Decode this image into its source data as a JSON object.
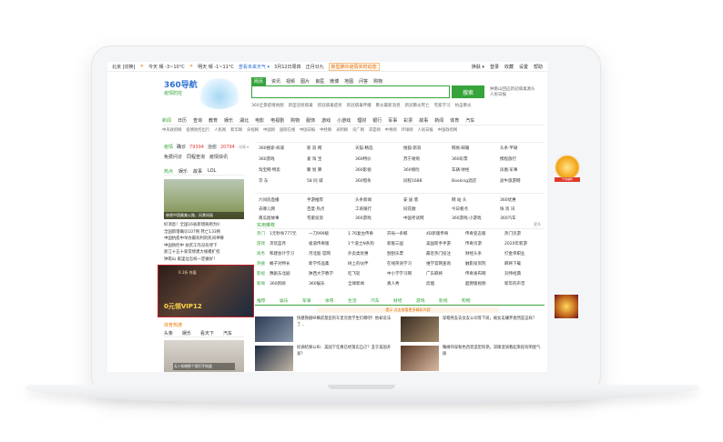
{
  "topbar": {
    "city": "北京 [切换]",
    "today": "今天 晴 -3~10°C",
    "tomorrow": "明天 晴 -1~11°C",
    "forecast": "查看未来天气 ▾",
    "date": "3月12日周四",
    "lunar": "正月廿九",
    "promo": "新型肺炎疫情实时动态",
    "links": [
      "登录",
      "收藏",
      "设置",
      "帮助"
    ],
    "skin": "换肤 ▾"
  },
  "logo": {
    "brand": "360",
    "name": "导航",
    "tag": "疫情防控"
  },
  "search_tabs": [
    "网页",
    "资讯",
    "视频",
    "图片",
    "良医",
    "微博",
    "地图",
    "问答",
    "购物"
  ],
  "search": {
    "placeholder": "",
    "button": "搜索",
    "hot": [
      "钟南山回应新冠病毒源头",
      "人民日报"
    ]
  },
  "hints": [
    "360全景疫情地图",
    "新型冠状病毒",
    "新冠病毒症状",
    "新冠病毒传播",
    "肺炎最新消息",
    "新冠肺炎死亡",
    "宅家学习",
    "抗击肺炎"
  ],
  "nav": [
    "新闻",
    "日历",
    "查询",
    "教育",
    "娱乐",
    "湖北",
    "电影",
    "电视剧",
    "购物",
    "服饰",
    "游戏",
    "小游戏",
    "理财",
    "银行",
    "军事",
    "彩票",
    "故事",
    "新闻",
    "体育",
    "汽车"
  ],
  "subnav": [
    "中央政府网",
    "疫情防控出行",
    "人民网",
    "新华网",
    "央视网",
    "中国网",
    "国际在线",
    "中国日报",
    "中经网",
    "光明网",
    "央广网",
    "求是网",
    "中青网",
    "环球网",
    "人民日报",
    "中国政府网"
  ],
  "left": {
    "weather": {
      "label": "疫情",
      "confirmed_label": "确诊",
      "confirmed": "79394",
      "cured_label": "治愈",
      "cured": "20794",
      "more": "详情 ▾"
    },
    "buttons": [
      "免费问诊",
      "同程查询",
      "疫情快讯"
    ],
    "tabs": [
      "热点",
      "娱乐",
      "故事",
      "LOL"
    ],
    "photo_caption": "俯视中国最美公路，风景如画",
    "news": [
      "好消息！全国16省新增病例为0",
      "全国新增确诊107例 死亡133例",
      "中国抗疫中举办最有利的民间神尊",
      "中国防控中 扶贫工作没有停下",
      "浙江十五十家常修建大规模扩招",
      "钟南山 家里边怎样一定做好！"
    ],
    "ad": {
      "line1": "0.1折 充值",
      "line2": "0元领VIP12"
    },
    "sports": {
      "label": "体育热搜",
      "tabs": [
        "头条",
        "娱乐",
        "看天下",
        "汽车"
      ],
      "caption": "无人知晓那个我们不知道"
    }
  },
  "grid": [
    [
      "360搜索·商城",
      "新 浪 网",
      "天猫·精选",
      "搜狐·新浪",
      "网易·邮箱",
      "头条·芊瑚"
    ],
    [
      "360游戏",
      "爱 淘 宝",
      "360特价",
      "苏宁易购",
      "360彩票",
      "携程旅行"
    ],
    [
      "淘宝网·特卖",
      "聚 划 算",
      "360影视",
      "360保险",
      "车辆·财经",
      "凤凰·军事"
    ],
    [
      "京 东",
      "58 同 城",
      "360借条",
      "同程1688",
      "Booking酒店",
      "途牛旅游网"
    ]
  ],
  "grid2": [
    [
      "六间房直播",
      "手游推荐",
      "头条新闻",
      "安 居 客",
      "网 站 头",
      "360优惠"
    ],
    [
      "去哪儿网",
      "百度·热点",
      "工商银行",
      "同花顺",
      "今日看点",
      "快 资 讯"
    ],
    [
      "南瓜屋故事",
      "宅家投资",
      "360游戏",
      "中国考试网",
      "360游戏·小游戏",
      "360汽车"
    ]
  ],
  "ent_header": {
    "title": "实用推荐",
    "more": "更多"
  },
  "ent": [
    [
      "热门",
      "1元秒杀777元",
      "一刀999级",
      "1.76复古传奇",
      "开局一条鲸",
      "4D新版传奇",
      "传奇变态版",
      "热门页游"
    ],
    [
      "游戏",
      "贪玩蓝月",
      "极道传奇版",
      "1个道士N条狗",
      "新版三国",
      "美国新手手游",
      "传奇页游",
      "2020年新游"
    ],
    [
      "商务",
      "和建会计学习",
      "河北股 官网",
      "外卖类优惠",
      "刮刮乐票",
      "最近热门投注",
      "财经头条",
      "打金单职业"
    ],
    [
      "热搜",
      "桶子对特长",
      "新学作品集",
      "树上的伙伴",
      "在线英语学习",
      "维学官网查询",
      "触影投资院",
      "麻将下载"
    ],
    [
      "影视",
      "豫剧东北剧",
      "陕西大学教学",
      "吃飞轮",
      "中小学学习网",
      "广东麻将",
      "传奇发布网",
      "刘伟经典"
    ],
    [
      "新闻",
      "360新闻",
      "360娱乐",
      "全球新闻",
      "真人秀",
      "炊烟",
      "超燃版视频",
      "新年的声音"
    ]
  ],
  "feed_tabs": [
    "推荐",
    "娱乐",
    "军事",
    "体育",
    "生活",
    "汽车",
    "财经",
    "游戏",
    "影视",
    "购物"
  ],
  "feed_note": "提示 点击查看更多精彩内容",
  "cards": [
    {
      "title": "快捷救援纵横诺基亚的车里究竟学生们哪吧！他却没法了…",
      "source": "360新闻"
    },
    {
      "title": "穿帽男友去女友公司等下班，被女友嫌弃竟然是这样？",
      "source": "新趣"
    },
    {
      "title": "民调结果公布：美国下任换已经落实自己？丑于美国开发？",
      "source": "环球"
    },
    {
      "title": "鞠婧祎穿粉色西装造型惊艳，双眼湿润看起来挺有明星气质",
      "source": "娱乐"
    }
  ],
  "side_badges": [
    "千场福利",
    "战斗"
  ]
}
